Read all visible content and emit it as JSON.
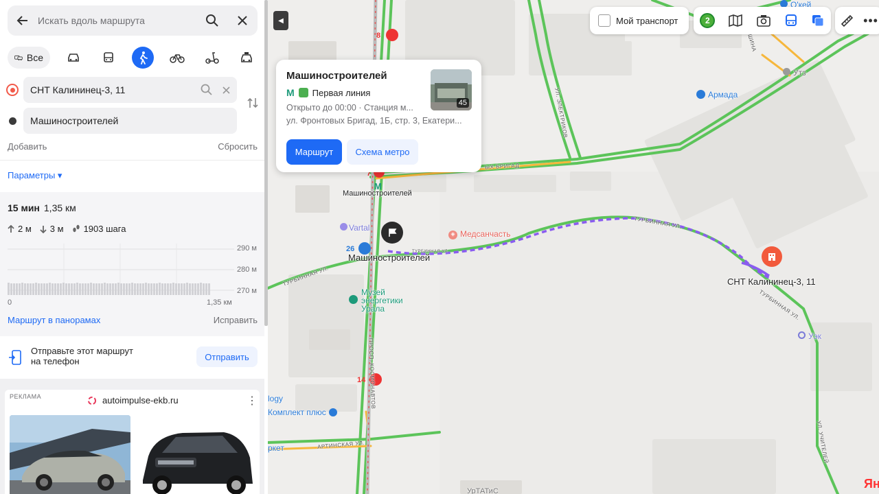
{
  "search": {
    "placeholder": "Искать вдоль маршрута"
  },
  "modes": {
    "all_label": "Все"
  },
  "route": {
    "from": "СНТ Калининец-3, 11",
    "to": "Машиностроителей",
    "add_label": "Добавить",
    "reset_label": "Сбросить",
    "params_label": "Параметры ▾"
  },
  "summary": {
    "time": "15 мин",
    "distance": "1,35 км",
    "ascent": "2 м",
    "descent": "3 м",
    "steps": "1903 шага"
  },
  "elevation": {
    "labels": [
      "290 м",
      "280 м",
      "270 м"
    ],
    "x_start": "0",
    "x_end": "1,35 км"
  },
  "actions": {
    "panoramas": "Маршрут в панорамах",
    "fix": "Исправить"
  },
  "send": {
    "text_line1": "Отправьте этот маршрут",
    "text_line2": "на телефон",
    "button": "Отправить"
  },
  "ad": {
    "label": "РЕКЛАМА",
    "site": "autoimpulse-ekb.ru",
    "more": "⋮"
  },
  "card": {
    "title": "Машиностроителей",
    "line": "Первая линия",
    "open": "Открыто до 00:00 · Станция м...",
    "address": "ул. Фронтовых Бригад, 1Б, стр. 3, Екатери...",
    "photo_count": "45",
    "route_button": "Маршрут",
    "metro_button": "Схема метро"
  },
  "toolbar": {
    "my_transport": "Мой транспорт",
    "traffic_level": "2"
  },
  "map_labels": {
    "metro_station": "Машиностроителей",
    "stop_label": "Машиностроителей",
    "destination": "СНТ Калининец-3, 11",
    "medsanchast": "Медсанчасть",
    "museum": "Музей энергетики Урала",
    "armada": "Армада",
    "okey": "О'кей",
    "utz": "Утз",
    "uek": "Уэк",
    "vartal": "Vartal",
    "komplekt": "Комплект плюс",
    "logy": "logy",
    "market": "ркет",
    "uratatis": "УрТАТиС",
    "ya": "Ян"
  },
  "stop_numbers": {
    "n8": "8",
    "n7": "7",
    "n26": "26",
    "n14": "14"
  },
  "streets": {
    "turbinnaya1": "ТУРБИННАЯ УЛ.",
    "turbinnaya2": "ТУРБИННАЯ УЛ.",
    "turbinnaya3": "ТУРБИННАЯ УЛ.",
    "turbinnaya4": "ТУРБИННАЯ УЛ.",
    "frontovyh": "ЫХ БРИГАД",
    "electrikov": "УЛ. ЭЛЕКТРИКОВ",
    "kosmonavtov": "ПРОСП. КОСМОНАВТОВ",
    "artinskaya": "АРТИНСКАЯ УЛ.",
    "uchiteley": "УЛ. УЧИТЕЛЕЙ",
    "shina": "ШИНА"
  },
  "colors": {
    "accent": "#1e6af5",
    "road_green": "#5cc45a",
    "road_yellow": "#f6b73c",
    "route_purple": "#8a5cf0",
    "pin_red": "#f25a3c"
  }
}
